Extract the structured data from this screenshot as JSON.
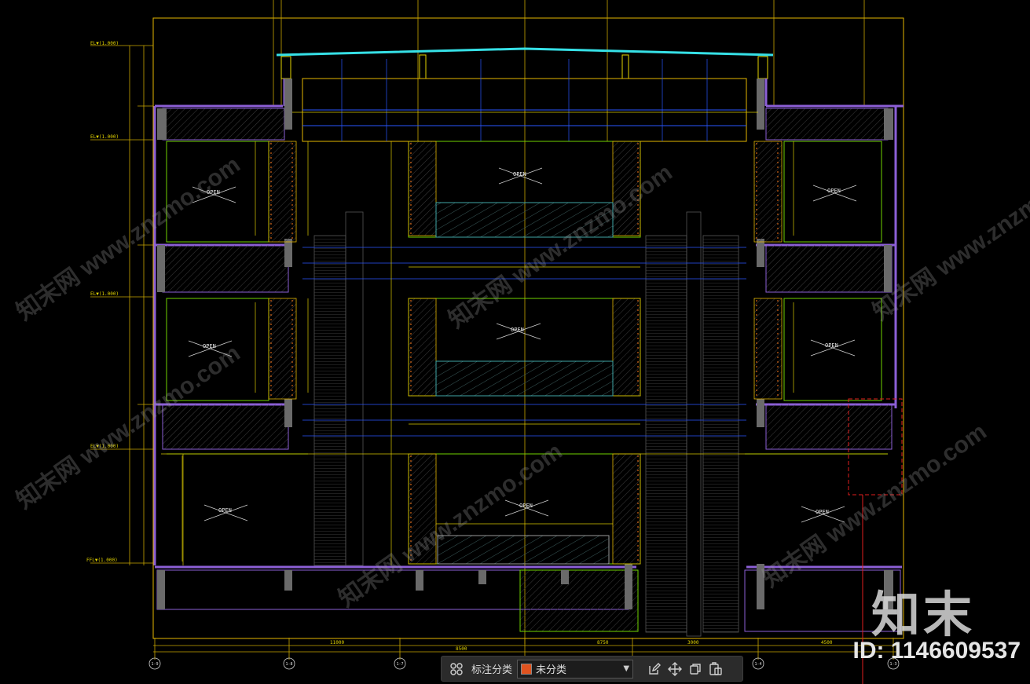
{
  "drawing": {
    "level_labels": [
      "EL▼(1.000)",
      "EL▼(1.000)",
      "EL▼(1.000)",
      "EL▼(1.000)",
      "FFL▼(1.000)"
    ],
    "room_labels": [
      "OPEN",
      "OPEN",
      "OPEN",
      "OPEN",
      "OPEN",
      "OPEN",
      "OPEN",
      "OPEN",
      "OPEN",
      "OPEN"
    ],
    "bottom_dims": [
      "11000",
      "8750",
      "3000",
      "8500",
      "4500"
    ],
    "axis_labels": [
      "1-9",
      "1-8",
      "1-7",
      "1-6",
      "1-5",
      "1-4",
      "1-3"
    ],
    "colors": {
      "structure": "#8c5fd6",
      "dimension": "#d9c900",
      "frame": "#e3b600",
      "grid_blue": "#2a56ff",
      "roof": "#36e0e6",
      "ceiling_green": "#6fd200",
      "highlight_red": "#e01e1e",
      "accent_orange": "#ff7a1a"
    }
  },
  "watermark": {
    "brand": "知末",
    "id": "ID: 1146609537",
    "diagonal": "知末网 www.znzmo.com"
  },
  "toolbar": {
    "label": "标注分类",
    "selected": "未分类",
    "swatch_color": "#e0531f",
    "icons": [
      "grid-icon",
      "edit-icon",
      "move-icon",
      "copy-icon",
      "paste-icon"
    ]
  }
}
